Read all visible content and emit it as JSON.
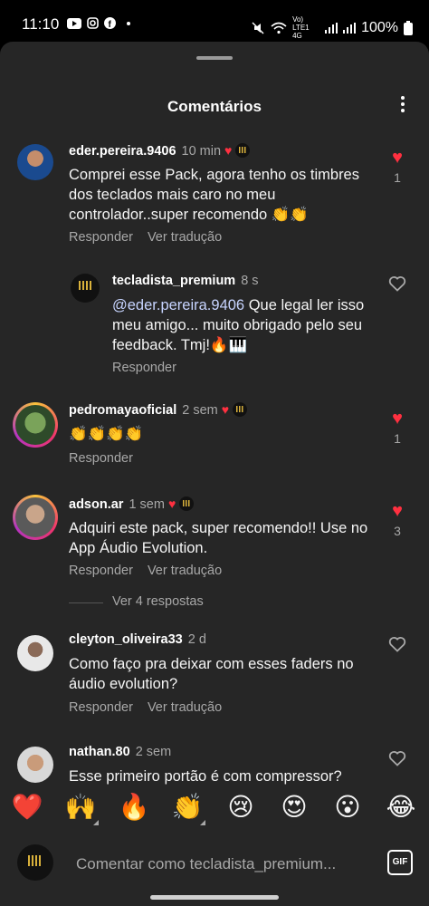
{
  "status": {
    "time": "11:10",
    "battery": "100%",
    "network": "Vo) LTE1 4G"
  },
  "sheet": {
    "title": "Comentários"
  },
  "comments": [
    {
      "user": "eder.pereira.9406",
      "time": "10 min",
      "text": "Comprei esse Pack, agora tenho os timbres dos teclados mais caro no meu controlador..super recomendo 👏👏",
      "reply": "Responder",
      "translate": "Ver tradução",
      "likes": "1"
    },
    {
      "user": "tecladista_premium",
      "time": "8 s",
      "mention": "@eder.pereira.9406",
      "text": " Que legal ler isso meu amigo... muito obrigado pelo seu feedback. Tmj!🔥🎹",
      "reply": "Responder"
    },
    {
      "user": "pedromayaoficial",
      "time": "2 sem",
      "text": "👏👏👏👏",
      "reply": "Responder",
      "likes": "1"
    },
    {
      "user": "adson.ar",
      "time": "1 sem",
      "text": "Adquiri este pack, super recomendo!! Use no App Áudio Evolution.",
      "reply": "Responder",
      "translate": "Ver tradução",
      "likes": "3",
      "view_replies": "Ver 4 respostas"
    },
    {
      "user": "cleyton_oliveira33",
      "time": "2 d",
      "text": "Como faço pra deixar com esses faders no áudio evolution?",
      "reply": "Responder",
      "translate": "Ver tradução"
    },
    {
      "user": "nathan.80",
      "time": "2 sem",
      "text": "Esse primeiro portão é com compressor?"
    }
  ],
  "emojis": [
    "❤️",
    "🙌",
    "🔥",
    "👏",
    "😢",
    "😍",
    "😮",
    "😂"
  ],
  "composer": {
    "placeholder": "Comentar como tecladista_premium...",
    "gif_label": "GIF"
  },
  "colors": {
    "background": "#262626",
    "accent_like": "#ff3040",
    "mention": "#c7d4ff"
  }
}
